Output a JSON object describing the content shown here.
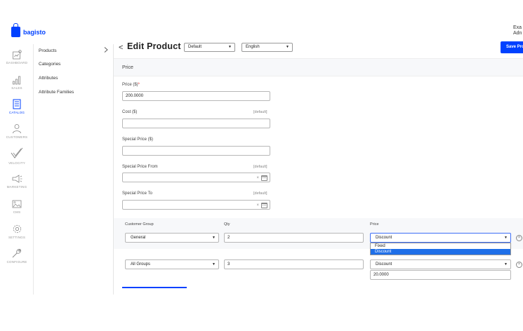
{
  "brand": {
    "name": "bagisto",
    "color": "#0041ff"
  },
  "user": {
    "line1": "Exa",
    "line2": "Adn"
  },
  "nav": [
    {
      "label": "DASHBOARD",
      "icon": "dashboard-icon"
    },
    {
      "label": "SALES",
      "icon": "sales-icon"
    },
    {
      "label": "CATALOG",
      "icon": "catalog-icon",
      "active": true
    },
    {
      "label": "CUSTOMERS",
      "icon": "customers-icon"
    },
    {
      "label": "VELOCITY",
      "icon": "velocity-icon"
    },
    {
      "label": "MARKETING",
      "icon": "marketing-icon"
    },
    {
      "label": "CMS",
      "icon": "cms-icon"
    },
    {
      "label": "SETTINGS",
      "icon": "settings-icon"
    },
    {
      "label": "CONFIGURE",
      "icon": "configure-icon"
    }
  ],
  "subnav": [
    {
      "label": "Products"
    },
    {
      "label": "Categories"
    },
    {
      "label": "Attributes"
    },
    {
      "label": "Attribute Families"
    }
  ],
  "header": {
    "back": "<",
    "title": "Edit Product",
    "channel_select": "Default",
    "locale_select": "English",
    "save_button": "Save Pro"
  },
  "section": {
    "title": "Price"
  },
  "fields": {
    "price": {
      "label": "Price ($)",
      "required_mark": "*",
      "value": "200.0000"
    },
    "cost": {
      "label": "Cost ($)",
      "scope": "[default]",
      "value": ""
    },
    "special_price": {
      "label": "Special Price ($)",
      "value": ""
    },
    "special_price_from": {
      "label": "Special Price From",
      "scope": "[default]",
      "value": "",
      "clear": "×"
    },
    "special_price_to": {
      "label": "Special Price To",
      "scope": "[default]",
      "value": "",
      "clear": "×"
    }
  },
  "group_price": {
    "headers": {
      "group": "Customer Group",
      "qty": "Qty",
      "price": "Price"
    },
    "rows": [
      {
        "group": "General",
        "qty": "2",
        "price_type": "Discount",
        "price_value": ""
      },
      {
        "group": "All Groups",
        "qty": "3",
        "price_type": "Discount",
        "price_value": "20.0000"
      }
    ],
    "dropdown_options": [
      "Fixed",
      "Discount"
    ],
    "dropdown_highlight": "Discount",
    "remove": "×"
  },
  "colors": {
    "accent": "#0041ff",
    "highlight": "#1f6fe8",
    "required": "#e02424"
  }
}
